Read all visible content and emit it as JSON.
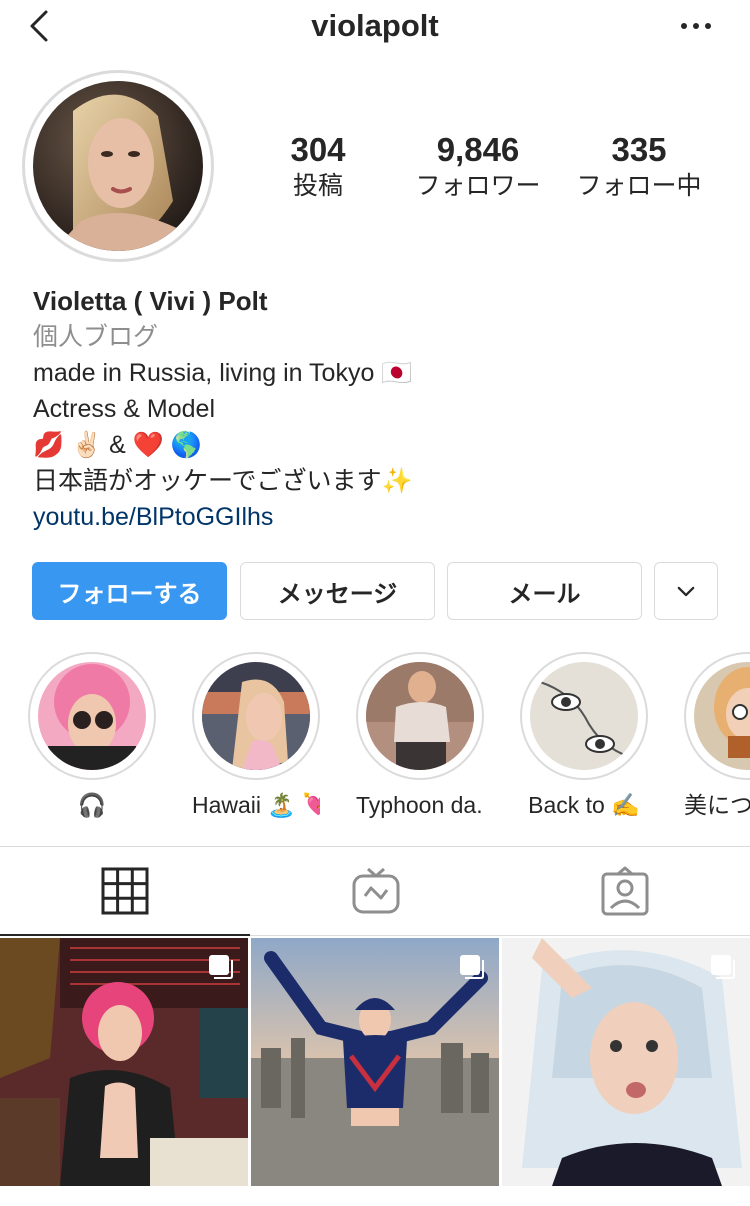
{
  "header": {
    "username": "violapolt",
    "back_icon": "chevron-left-icon",
    "more_icon": "more-horizontal-icon"
  },
  "stats": [
    {
      "value": "304",
      "label": "投稿"
    },
    {
      "value": "9,846",
      "label": "フォロワー"
    },
    {
      "value": "335",
      "label": "フォロー中"
    }
  ],
  "bio": {
    "name": "Violetta ( Vivi ) Polt",
    "category": "個人ブログ",
    "lines": [
      "made in Russia, living in Tokyo 🇯🇵",
      "Actress & Model",
      "💋 ✌🏻 & ❤️ 🌎",
      "日本語がオッケーでございます✨"
    ],
    "link": "youtu.be/BlPtoGGIlhs"
  },
  "buttons": {
    "follow": "フォローする",
    "message": "メッセージ",
    "mail": "メール",
    "more_icon": "chevron-down-icon"
  },
  "highlights": [
    {
      "label": "🎧"
    },
    {
      "label": "Hawaii 🏝️ 💘"
    },
    {
      "label": "Typhoon da..."
    },
    {
      "label": "Back to ✍️"
    },
    {
      "label": "美につい"
    }
  ],
  "tabs": [
    {
      "icon": "grid-icon",
      "active": true
    },
    {
      "icon": "igtv-icon",
      "active": false
    },
    {
      "icon": "tagged-icon",
      "active": false
    }
  ],
  "colors": {
    "accent": "#3897f0",
    "link": "#003569",
    "text": "#262626",
    "secondary": "#8e8e8e",
    "border": "#dbdbdb"
  }
}
